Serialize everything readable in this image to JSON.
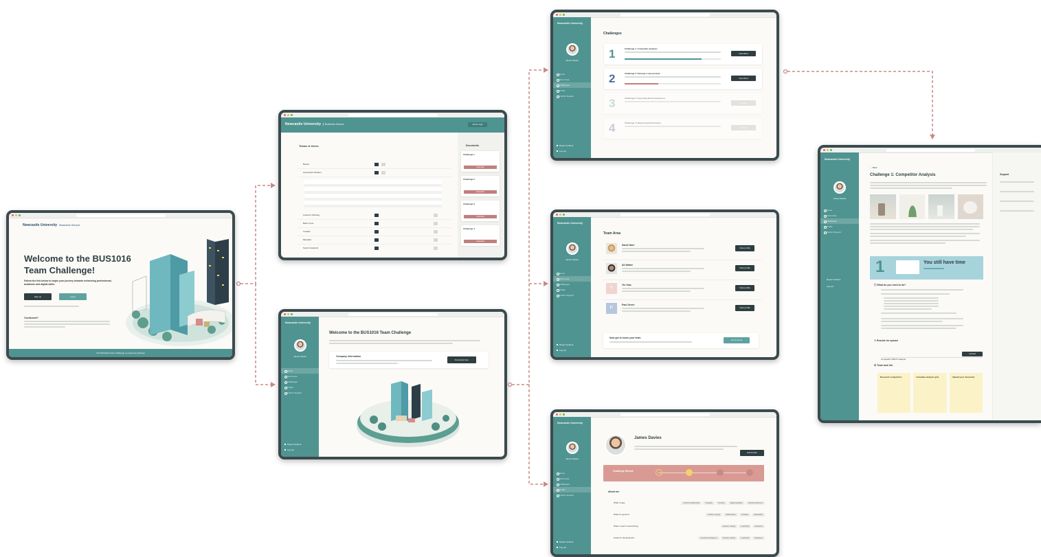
{
  "university": {
    "name": "Newcastle University",
    "school": "Business School"
  },
  "login": {
    "title": "Welcome to the BUS1016 Team Challenge!",
    "subtitle": "Follow the link below to begin your journey towards enhancing professional, academic and digital skills.",
    "signup": "Sign up",
    "login": "Log in",
    "confused_heading": "Confused?",
    "footer": "The BUS1016 Team Challenge is powered by Brainer"
  },
  "teams": {
    "admin_label": "Admin login",
    "title": "Teams & Users",
    "documents_title": "Documents",
    "rows": [
      "Boston",
      "Greenhead Strollers",
      "Lutterton Parkway",
      "Back Cross",
      "Tresider",
      "Mandard",
      "South Gowlands"
    ],
    "documents": [
      "Challenge 1",
      "Challenge 2",
      "Challenge 3",
      "Challenge 4"
    ],
    "download": "Download"
  },
  "welcome": {
    "title": "Welcome to the BUS1016 Team Challenge",
    "company_title": "Company information",
    "download_label": "Download here"
  },
  "sidebar": {
    "user": "James Davies",
    "items": [
      "Home",
      "Team Area",
      "Challenges",
      "Profile",
      "Further Support"
    ],
    "report": "Report Incident",
    "logout": "Log out"
  },
  "challenges": {
    "title": "Challenges",
    "items": [
      {
        "num": "1",
        "title": "Challenge 1: Competitor Analysis",
        "button": "View Brief",
        "progress": 0.8,
        "locked": false
      },
      {
        "num": "2",
        "title": "Challenge 2: Develop a new product",
        "button": "View Brief",
        "progress": 0.35,
        "locked": false
      },
      {
        "num": "3",
        "title": "Challenge 3: Improving Brand Awareness",
        "button": "Locked",
        "progress": 0,
        "locked": true
      },
      {
        "num": "4",
        "title": "Challenge 4: Measuring Performance",
        "button": "Locked",
        "progress": 0,
        "locked": true
      }
    ]
  },
  "team_area": {
    "title": "Team Area",
    "members": [
      {
        "name": "Sarah Dare",
        "initial": ""
      },
      {
        "name": "Ali Walter",
        "initial": ""
      },
      {
        "name": "Yin Xiao",
        "initial": "Y"
      },
      {
        "name": "Paul Green",
        "initial": "P"
      }
    ],
    "view_profile": "View profile",
    "know_team_title": "Now get to know your team",
    "get_to_know": "Get to know"
  },
  "profile": {
    "name": "James Davies",
    "edit": "Edit Profile",
    "review": "Challenge Review",
    "about": "About me",
    "rows": [
      {
        "label": "What I enjoy",
        "tags": [
          "Social & collaborative",
          "Creativity",
          "Curiosity",
          "Digital capability",
          "Cultural awareness"
        ]
      },
      {
        "label": "What I'm good at",
        "tags": [
          "Problem solving",
          "Collaboration",
          "Creativity",
          "Adaptability"
        ]
      },
      {
        "label": "What I need to avoid doing",
        "tags": [
          "Decision making",
          "Leadership",
          "Resilience"
        ]
      },
      {
        "label": "Areas for development",
        "tags": [
          "Emotional intelligence",
          "Decision making",
          "Leadership",
          "Resilience"
        ]
      }
    ]
  },
  "detail": {
    "back": "Back",
    "title": "Challenge 1: Competitor Analysis",
    "support": "Support",
    "banner_big": "You still have time",
    "banner_num": "1",
    "what_todo": "What do you need to do?",
    "results": "Results for upload",
    "upload_value": "Competitor SWOT analysis",
    "upload_btn": "Upload",
    "task_list": "Team task list",
    "tasks": [
      "Research competitors",
      "Complete analysis grid",
      "Upload your document"
    ]
  },
  "colors": {
    "teal": "#4f9490",
    "dark": "#2f3e41",
    "connector": "#c98a86"
  }
}
